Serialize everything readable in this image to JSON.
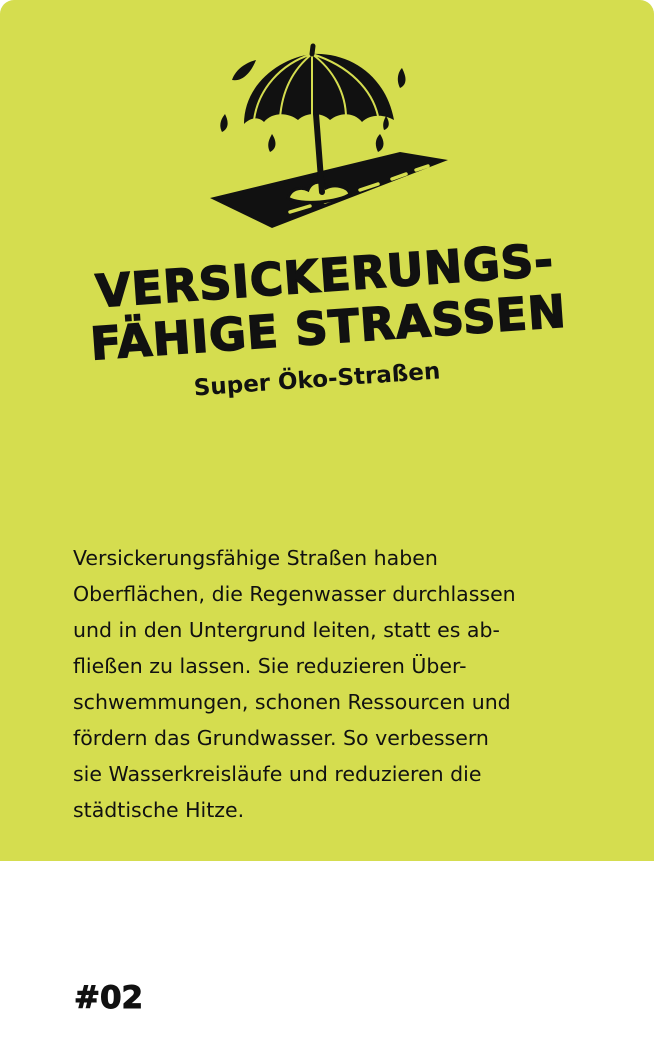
{
  "card": {
    "background_color": "#d5dd4f",
    "illustration_icon": "umbrella-over-road-icon",
    "title_line_1": "VERSICKERUNGS-",
    "title_line_2": "FÄHIGE STRASSEN",
    "subtitle": "Super Öko-Straßen",
    "description_lines": [
      "Versickerungsfähige Straßen haben",
      "Oberflächen, die Regenwasser durchlassen",
      "und in den Untergrund leiten, statt es ab-",
      "fließen zu lassen. Sie reduzieren Über-",
      "schwemmungen, schonen Ressourcen und",
      "fördern das Grundwasser. So verbessern",
      "sie Wasserkreisläufe und reduzieren die",
      "städtische Hitze."
    ]
  },
  "footer": {
    "number": "#02"
  }
}
